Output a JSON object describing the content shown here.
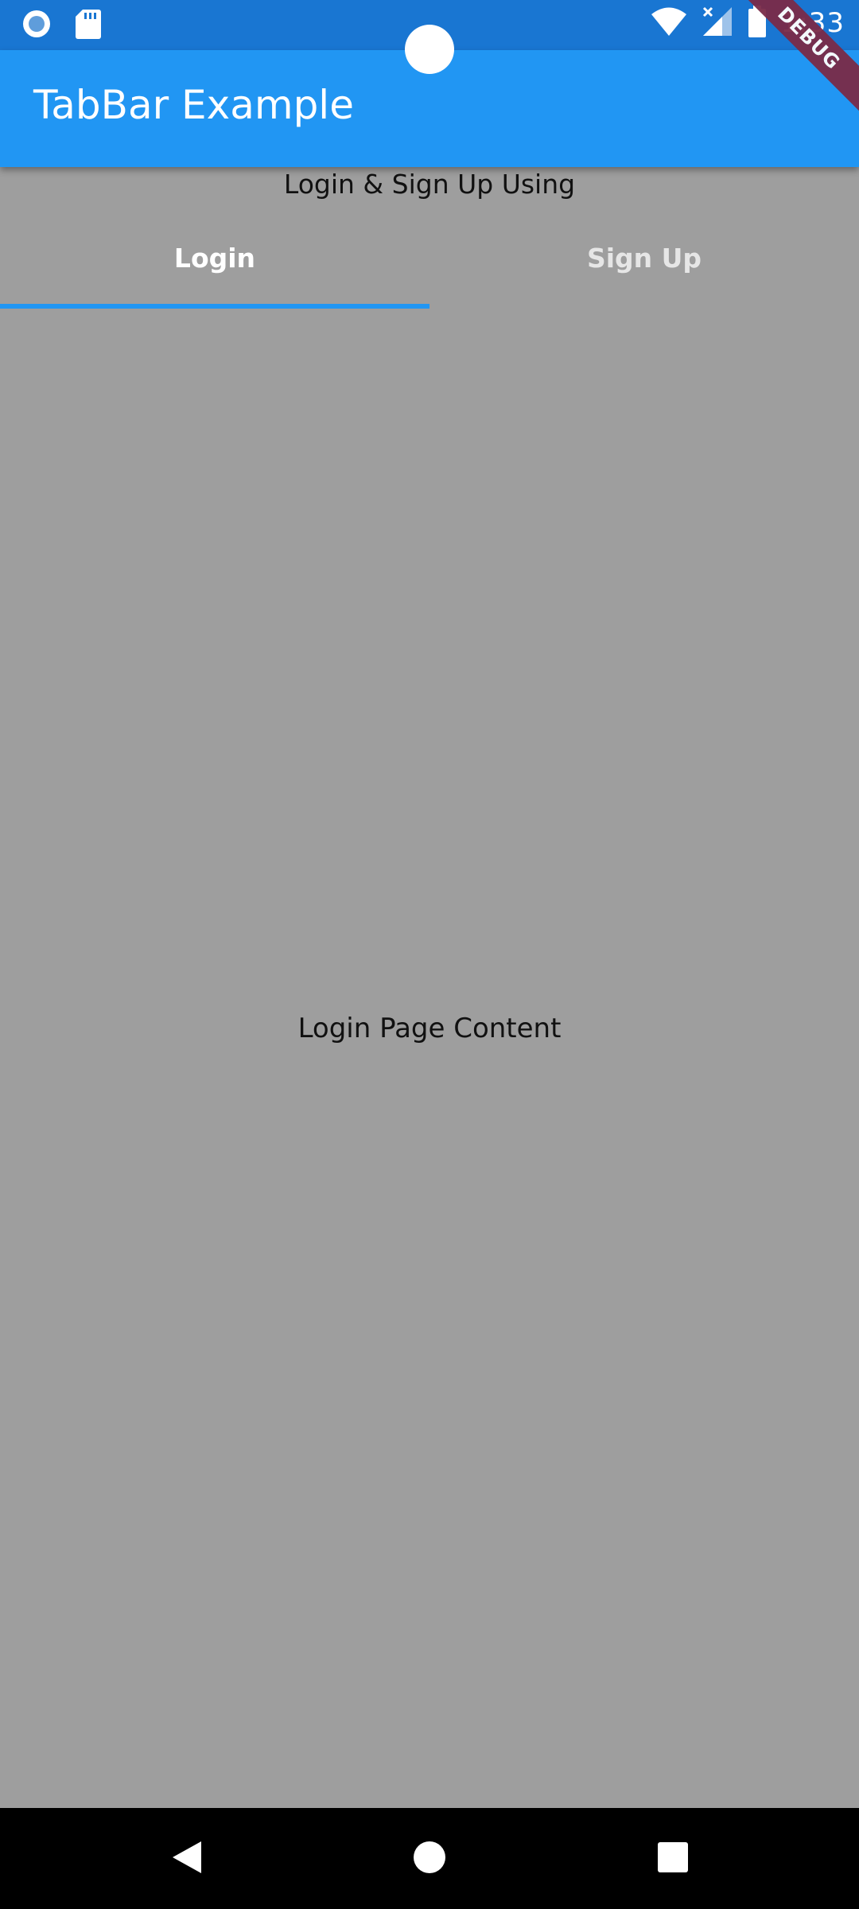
{
  "status_bar": {
    "time": "1:33",
    "icons": [
      "record-icon",
      "sd-card-icon",
      "wifi-icon",
      "signal-icon",
      "battery-icon"
    ]
  },
  "app_bar": {
    "title": "TabBar Example",
    "debug_label": "DEBUG"
  },
  "subtitle": "Login & Sign Up Using",
  "tabs": [
    {
      "label": "Login",
      "active": true
    },
    {
      "label": "Sign Up",
      "active": false
    }
  ],
  "content": {
    "text": "Login Page Content"
  },
  "nav_bar": {
    "icons": [
      "back-icon",
      "home-icon",
      "recents-icon"
    ]
  },
  "colors": {
    "status_bar": "#1976d2",
    "app_bar": "#2196f3",
    "background": "#9e9e9e",
    "indicator": "#2196f3",
    "debug_ribbon": "#7a2b48"
  }
}
